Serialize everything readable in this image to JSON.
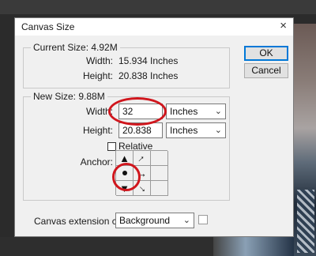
{
  "dialog": {
    "title": "Canvas Size",
    "close_glyph": "×",
    "current_size": {
      "legend": "Current Size: 4.92M",
      "width_label": "Width:",
      "width_value": "15.934 Inches",
      "height_label": "Height:",
      "height_value": "20.838 Inches"
    },
    "new_size": {
      "legend": "New Size: 9.88M",
      "width_label": "Width:",
      "width_value": "32",
      "width_unit": "Inches",
      "height_label": "Height:",
      "height_value": "20.838",
      "height_unit": "Inches",
      "relative_label": "Relative",
      "relative_checked": false,
      "anchor_label": "Anchor:",
      "anchor_selected": "middle-left"
    },
    "buttons": {
      "ok": "OK",
      "cancel": "Cancel"
    },
    "extension": {
      "label": "Canvas extension color:",
      "value": "Background"
    }
  },
  "annotation_color": "#d0161d"
}
